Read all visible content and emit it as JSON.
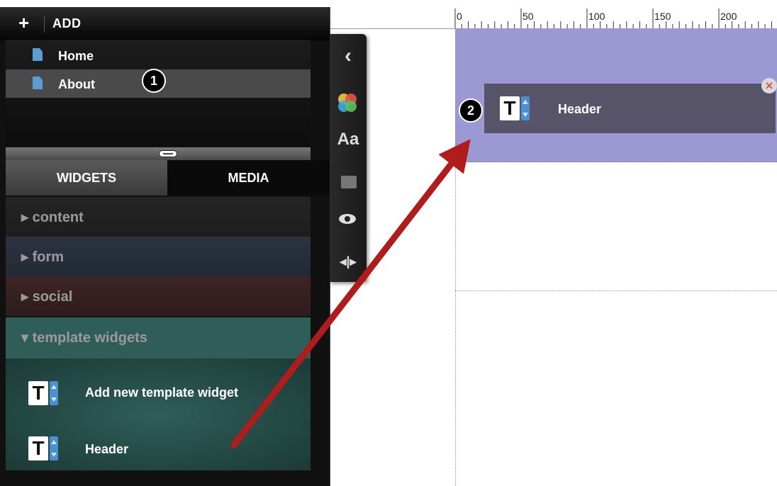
{
  "add_bar": {
    "plus": "+",
    "label": "ADD"
  },
  "pages": [
    {
      "label": "Home",
      "selected": false
    },
    {
      "label": "About",
      "selected": true
    }
  ],
  "panel_tabs": {
    "widgets": "WIDGETS",
    "media": "MEDIA"
  },
  "categories": [
    {
      "label": "▸ content",
      "color": "#242424"
    },
    {
      "label": "▸ form",
      "color": "#2a3340"
    },
    {
      "label": "▸ social",
      "color": "#3d2424"
    },
    {
      "label": "▾ template widgets",
      "color": "#2f5e58",
      "expanded": true
    }
  ],
  "template_widgets": [
    {
      "label": "Add new template widget"
    },
    {
      "label": "Header"
    }
  ],
  "toolbar": {
    "collapse": "‹",
    "fonts": "Aa",
    "resize": "◂|▸",
    "icons": [
      "chevron-left-icon",
      "color-circles-icon",
      "font-icon",
      "texture-icon",
      "eye-icon",
      "resize-icon"
    ]
  },
  "ruler": {
    "ticks": [
      "0",
      "50",
      "100",
      "150",
      "200"
    ]
  },
  "canvas": {
    "header_widget_label": "Header",
    "close_glyph": "×",
    "region_color": "#9b98d4"
  },
  "badges": {
    "step1": "1",
    "step2": "2"
  },
  "colors": {
    "arrow": "#b01c1c",
    "accent_blue": "#4a8fd0"
  }
}
